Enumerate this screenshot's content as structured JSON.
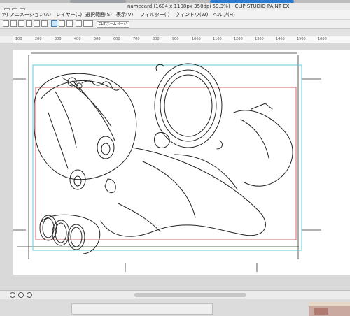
{
  "window": {
    "title": "namecard (1604 x 1108px 350dpi 59.3%)  - CLIP STUDIO PAINT EX"
  },
  "menu": {
    "items": [
      {
        "label": "ァ)"
      },
      {
        "label": "アニメーション(A)"
      },
      {
        "label": "レイヤー(L)"
      },
      {
        "label": "選択範囲(S)"
      },
      {
        "label": "表示(V)"
      },
      {
        "label": "フィルター(I)"
      },
      {
        "label": "ウィンドウ(W)"
      },
      {
        "label": "ヘルプ(H)"
      }
    ]
  },
  "toolbar": {
    "home_label": "CLIPホームページ"
  },
  "ruler": {
    "labels": [
      "100",
      "200",
      "300",
      "400",
      "500",
      "600",
      "700",
      "800",
      "900",
      "1000",
      "1100",
      "1200",
      "1300",
      "1400",
      "1500",
      "1600"
    ]
  },
  "colors": {
    "bleed_cyan": "#63c9d8",
    "safe_red": "#d8646d",
    "line_art": "#222222"
  }
}
